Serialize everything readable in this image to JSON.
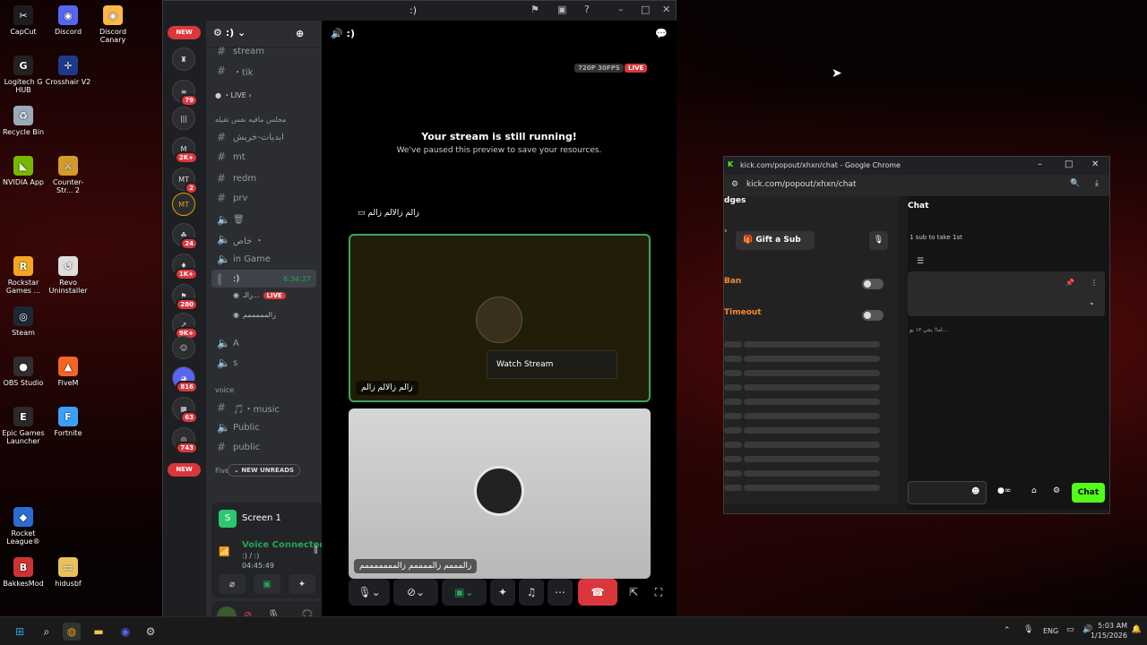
{
  "desktop": {
    "icons": [
      {
        "label": "CapCut",
        "color": "#1d1d1d",
        "glyph": "✂"
      },
      {
        "label": "Discord",
        "color": "#5865f2",
        "glyph": "◉"
      },
      {
        "label": "Discord Canary",
        "color": "#fbb848",
        "glyph": "◉"
      },
      {
        "label": "Logitech G HUB",
        "color": "#222",
        "glyph": "G"
      },
      {
        "label": "Crosshair V2",
        "color": "#1e3a8a",
        "glyph": "✛"
      },
      {
        "label": "Recycle Bin",
        "color": "#9ab",
        "glyph": "♻"
      },
      {
        "label": "NVIDIA App",
        "color": "#76b900",
        "glyph": "◣"
      },
      {
        "label": "Counter-Str... 2",
        "color": "#d39b2a",
        "glyph": "⚔"
      },
      {
        "label": "Rockstar Games ...",
        "color": "#f5a623",
        "glyph": "R"
      },
      {
        "label": "Revo Uninstaller",
        "color": "#dddddd",
        "glyph": "↺"
      },
      {
        "label": "Steam",
        "color": "#1b2838",
        "glyph": "◎"
      },
      {
        "label": "OBS Studio",
        "color": "#302e31",
        "glyph": "●"
      },
      {
        "label": "FiveM",
        "color": "#f26522",
        "glyph": "▲"
      },
      {
        "label": "Epic Games Launcher",
        "color": "#2a2a2a",
        "glyph": "E"
      },
      {
        "label": "Fortnite",
        "color": "#3aa0ff",
        "glyph": "F"
      },
      {
        "label": "Rocket League®",
        "color": "#2b6cd4",
        "glyph": "◆"
      },
      {
        "label": "BakkesMod",
        "color": "#c33",
        "glyph": "B"
      },
      {
        "label": "hidusbf",
        "color": "#e8c15c",
        "glyph": "▭"
      }
    ]
  },
  "discord": {
    "window_title": ":)",
    "server_name": ":)",
    "guilds": {
      "new_label": "NEW",
      "badges": [
        "79",
        "2K+",
        "2",
        "24",
        "1K+",
        "280",
        "9K+",
        "816",
        "63",
        "743"
      ],
      "new_bottom": "NEW"
    },
    "channels": [
      {
        "type": "text",
        "name": "stream"
      },
      {
        "type": "text",
        "name": "・tik"
      },
      {
        "type": "category-live",
        "name": "・LIVE ›"
      },
      {
        "type": "category",
        "name": "مجلس مافيه نفس ثقيله"
      },
      {
        "type": "text",
        "name": "ابديات-خربش"
      },
      {
        "type": "text",
        "name": "mt"
      },
      {
        "type": "text",
        "name": "redm"
      },
      {
        "type": "text",
        "name": "prv"
      },
      {
        "type": "voice",
        "name": "🗑"
      },
      {
        "type": "voice",
        "name": "خاص ・"
      },
      {
        "type": "voice",
        "name": "in Game"
      },
      {
        "type": "voice-active",
        "name": ":)",
        "timer": "6:34:27"
      },
      {
        "type": "voice",
        "name": "A"
      },
      {
        "type": "voice",
        "name": "s"
      },
      {
        "type": "category",
        "name": "voice"
      },
      {
        "type": "text",
        "name": "🎵・music"
      },
      {
        "type": "voice",
        "name": "Public"
      },
      {
        "type": "text",
        "name": "public"
      }
    ],
    "voice_users": [
      {
        "name": "زالـ...",
        "live": "LIVE"
      },
      {
        "name": "زالمممممم"
      }
    ],
    "five_label": "Five",
    "new_unreads": "NEW UNREADS",
    "voice_panel": {
      "screen_label": "Screen 1",
      "status": "Voice Connected",
      "channel": ":) / :)",
      "elapsed": "04:45:49"
    },
    "main": {
      "header_title": ":)",
      "quality": "720P 30FPS",
      "live": "LIVE",
      "paused_title": "Your stream is still running!",
      "paused_sub": "We've paused this preview to save your resources.",
      "stream_user_label": "زالم زالالم زالم",
      "tile1_name": "زالم زالالم زالم",
      "watch_button": "Watch Stream",
      "tile2_name": "زالمممم زالممممم زالمممممممم"
    }
  },
  "chrome": {
    "title": "kick.com/popout/xhxn/chat - Google Chrome",
    "url": "kick.com/popout/xhxn/chat",
    "left": {
      "header": "dges",
      "gift_sub": "Gift a Sub",
      "ban": "Ban",
      "timeout": "Timeout"
    },
    "right": {
      "chat_header": "Chat",
      "sub_text": "1 sub to take 1st",
      "message": "اما! يجي ١٣ يو...",
      "chat_button": "Chat"
    }
  },
  "taskbar": {
    "lang": "ENG",
    "time": "5:03 AM",
    "date": "1/15/2026"
  }
}
